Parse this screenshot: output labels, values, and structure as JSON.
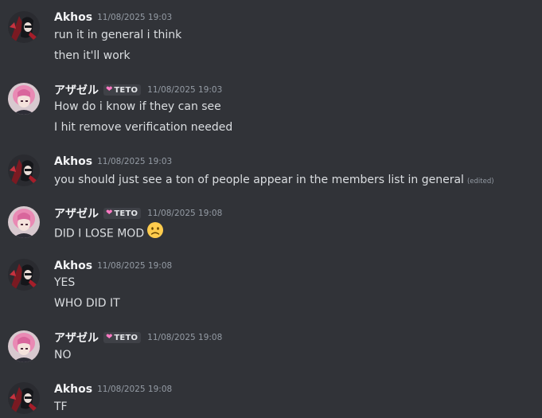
{
  "users": {
    "akhos": {
      "name": "Akhos"
    },
    "azazel": {
      "name": "アザゼル",
      "tag": "TETO"
    }
  },
  "messages": [
    {
      "author": "Akhos",
      "timestamp": "11/08/2025 19:03",
      "lines": [
        "run it in general i think",
        "then it'll work"
      ]
    },
    {
      "author": "アザゼル",
      "tag": "TETO",
      "timestamp": "11/08/2025 19:03",
      "lines": [
        "How do i know if they can see",
        "I hit remove verification needed"
      ]
    },
    {
      "author": "Akhos",
      "timestamp": "11/08/2025 19:03",
      "lines": [
        "you should just see a ton of people appear in the members list in general"
      ],
      "edited_label": "(edited)"
    },
    {
      "author": "アザゼル",
      "tag": "TETO",
      "timestamp": "11/08/2025 19:08",
      "lines": [
        "DID I LOSE MOD"
      ],
      "emoji": "slightly-frowning-face"
    },
    {
      "author": "Akhos",
      "timestamp": "11/08/2025 19:08",
      "lines": [
        "YES",
        "WHO DID IT"
      ]
    },
    {
      "author": "アザゼル",
      "tag": "TETO",
      "timestamp": "11/08/2025 19:08",
      "lines": [
        "NO"
      ]
    },
    {
      "author": "Akhos",
      "timestamp": "11/08/2025 19:08",
      "lines": [
        "TF"
      ]
    }
  ],
  "colors": {
    "background": "#313338",
    "username": "#f2f3f5",
    "message_text": "#dbdee1",
    "timestamp": "#949ba4",
    "tag_background": "#3f4147",
    "tag_heart": "#ff7ac4"
  }
}
